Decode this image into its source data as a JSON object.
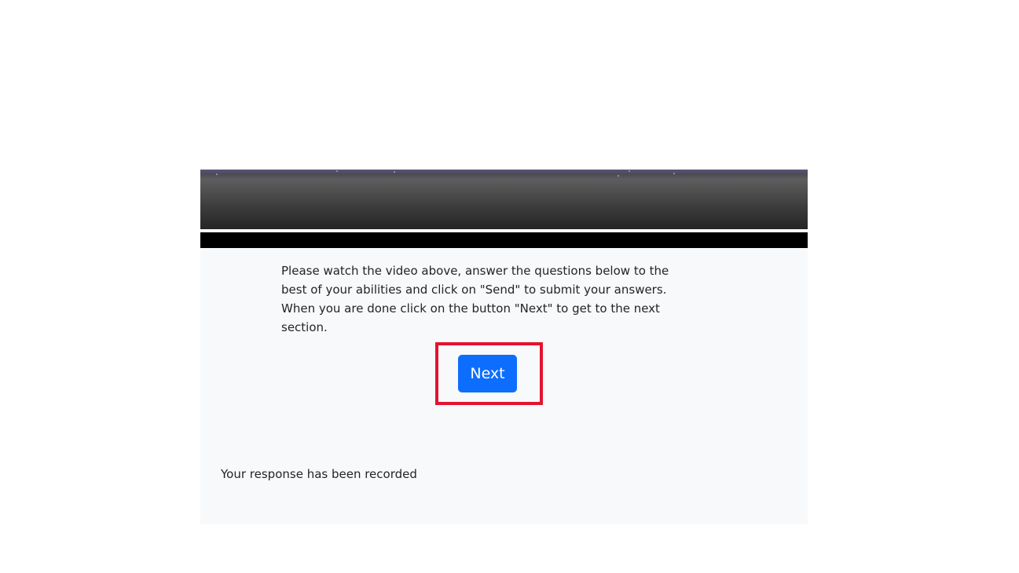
{
  "instructions": {
    "text": "Please watch the video above, answer the questions below to the best of your abilities and click on \"Send\" to submit your answers. When you are done click on the button \"Next\" to get to the next section."
  },
  "navigation": {
    "next_label": "Next"
  },
  "status": {
    "message": "Your response has been recorded"
  },
  "colors": {
    "primary_button": "#0d6efd",
    "highlight_border": "#e3132f",
    "card_background": "#f8f9fa"
  }
}
